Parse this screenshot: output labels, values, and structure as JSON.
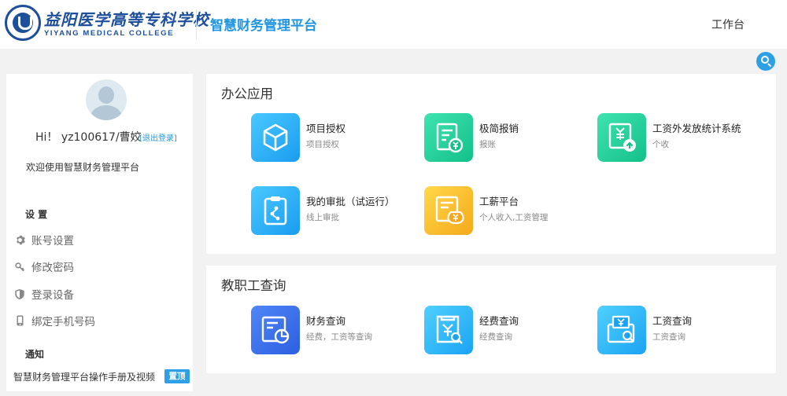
{
  "header": {
    "logo_cn": "益阳医学高等专科学校",
    "logo_en": "YIYANG MEDICAL COLLEGE",
    "platform_title": "智慧财务管理平台",
    "workbench_label": "工作台"
  },
  "search": {
    "icon": "search-icon",
    "color": "#2ea0e6"
  },
  "sidebar": {
    "greeting": "Hi！ yz100617/曹姣",
    "logout": "[退出登录]",
    "welcome": "欢迎使用智慧财务管理平台",
    "settings_title": "设 置",
    "settings_items": [
      {
        "icon": "gear-icon",
        "label": "账号设置"
      },
      {
        "icon": "key-icon",
        "label": "修改密码"
      },
      {
        "icon": "shield-icon",
        "label": "登录设备"
      },
      {
        "icon": "phone-icon",
        "label": "绑定手机号码"
      }
    ],
    "notice_title": "通知",
    "notice_text": "智慧财务管理平台操作手册及视频",
    "notice_badge": "置顶"
  },
  "office": {
    "title": "办公应用",
    "apps": [
      {
        "icon": "cube-icon",
        "name": "项目授权",
        "desc": "项目授权",
        "color": "#1a9cf0"
      },
      {
        "icon": "invoice-yen-icon",
        "name": "极简报销",
        "desc": "报账",
        "color": "#13c08a"
      },
      {
        "icon": "salary-upload-icon",
        "name": "工资外发放统计系统",
        "desc": "个收",
        "color": "#13c08a"
      },
      {
        "icon": "clipboard-approval-icon",
        "name": "我的审批（试运行）",
        "desc": "线上审批",
        "color": "#1a9cf0"
      },
      {
        "icon": "payroll-bag-icon",
        "name": "工薪平台",
        "desc": "个人收入,工资管理",
        "color": "#f5a91a"
      }
    ]
  },
  "staff": {
    "title": "教职工查询",
    "apps": [
      {
        "icon": "finance-chart-icon",
        "name": "财务查询",
        "desc": "经费，工资等查询",
        "color": "#2d5fe0"
      },
      {
        "icon": "fund-search-icon",
        "name": "经费查询",
        "desc": "经费查询",
        "color": "#1ba3f2"
      },
      {
        "icon": "salary-search-icon",
        "name": "工资查询",
        "desc": "工资查询",
        "color": "#1ba3f2"
      }
    ]
  }
}
